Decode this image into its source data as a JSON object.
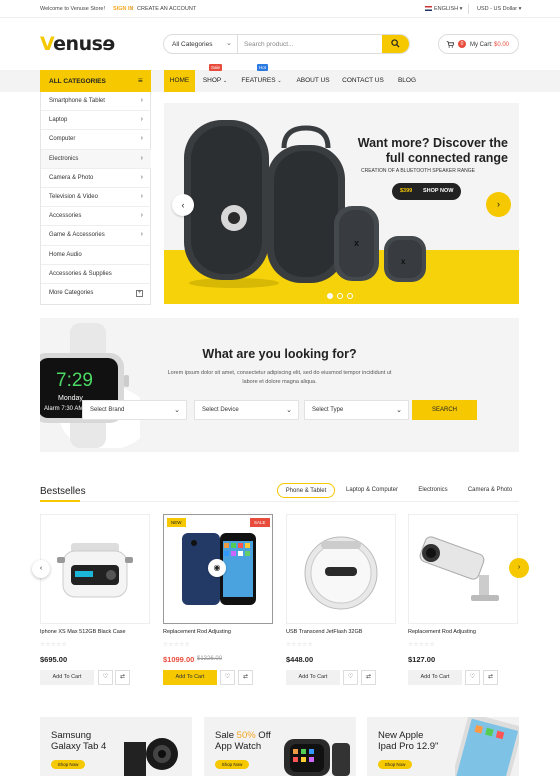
{
  "topbar": {
    "welcome": "Welcome to Venuse Store!",
    "signin": "SIGN IN",
    "separator": "/",
    "create": "CREATE AN ACCOUNT",
    "language": "ENGLISH",
    "currency": "USD - US Dollar"
  },
  "header": {
    "logo_v": "V",
    "logo_rest": "enusɘ",
    "search_category": "All Categories",
    "search_placeholder": "Search product...",
    "cart_count": "0",
    "cart_label": "My Cart:",
    "cart_amount": "$0.00"
  },
  "nav": {
    "all_categories": "ALL CATEGORIES",
    "items": [
      "HOME",
      "SHOP",
      "FEATURES",
      "ABOUT US",
      "CONTACT US",
      "BLOG"
    ],
    "shop_badge": "Sale",
    "features_badge": "Hot"
  },
  "sidebar": {
    "items": [
      "Smartphone & Tablet",
      "Laptop",
      "Computer",
      "Electronics",
      "Camera & Photo",
      "Television & Video",
      "Accessories",
      "Game & Accessories",
      "Home Audio",
      "Accessories & Supplies",
      "More Categories"
    ]
  },
  "hero": {
    "headline_1": "Want more? Discover the",
    "headline_2": "full connected range",
    "subtitle": "CREATION OF A BLUETOOTH SPEAKER RANGE",
    "price": "$399",
    "cta": "SHOP NOW"
  },
  "finder": {
    "title": "What are you looking for?",
    "desc": "Lorem ipsum dolor sit amet, consectetur adipiscing elit, sed do eiusmod tempor incididunt ut labore et dolore magna aliqua.",
    "select_brand": "Select Brand",
    "select_device": "Select Device",
    "select_type": "Select Type",
    "search": "SEARCH",
    "watch_time": "7:29",
    "watch_day": "Monday",
    "watch_alarm": "Alarm 7:30 AM"
  },
  "bestsellers": {
    "title": "Bestselles",
    "tabs": [
      "Phone & Tablet",
      "Laptop & Computer",
      "Electronics",
      "Camera & Photo"
    ],
    "products": [
      {
        "name": "Iphone XS Max 512GB Black Case",
        "price": "$695.00",
        "old": ""
      },
      {
        "name": "Replacement Rod Adjusting",
        "price": "$1099.00",
        "old": "$1326.00"
      },
      {
        "name": "USB Transcend JetFlash 32GB",
        "price": "$448.00",
        "old": ""
      },
      {
        "name": "Replacement Rod Adjusting",
        "price": "$127.00",
        "old": ""
      }
    ],
    "add_to_cart": "Add To Cart",
    "tag_new": "NEW",
    "tag_sale": "SALE",
    "stars": "☆☆☆☆☆"
  },
  "promos": [
    {
      "line1": "Samsung",
      "line2": "Galaxy Tab 4",
      "cta": "Shop Now"
    },
    {
      "line1_pre": "Sale ",
      "line1_hl": "50%",
      "line1_post": " Off",
      "line2": "App Watch",
      "cta": "Shop Now"
    },
    {
      "line1": "New Apple",
      "line2": "Ipad Pro 12.9\"",
      "cta": "Shop Now"
    }
  ],
  "colors": {
    "accent": "#f5c800",
    "sale": "#e74c3c"
  }
}
